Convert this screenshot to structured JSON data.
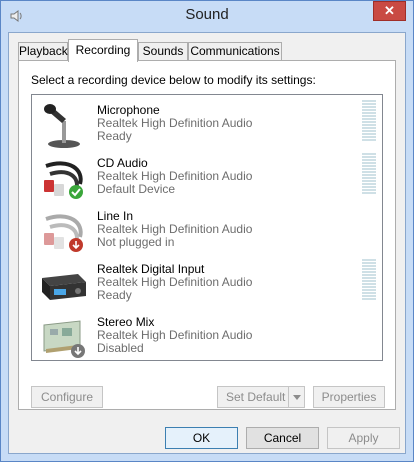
{
  "window": {
    "title": "Sound",
    "close_glyph": "✕"
  },
  "tabs": [
    {
      "label": "Playback",
      "active": false
    },
    {
      "label": "Recording",
      "active": true
    },
    {
      "label": "Sounds",
      "active": false
    },
    {
      "label": "Communications",
      "active": false
    }
  ],
  "instruction": "Select a recording device below to modify its settings:",
  "devices": [
    {
      "name": "Microphone",
      "description": "Realtek High Definition Audio",
      "status": "Ready",
      "icon": "microphone-icon",
      "has_meter": true,
      "badge": ""
    },
    {
      "name": "CD Audio",
      "description": "Realtek High Definition Audio",
      "status": "Default Device",
      "icon": "cd-audio-cable-icon",
      "has_meter": true,
      "badge": "check"
    },
    {
      "name": "Line In",
      "description": "Realtek High Definition Audio",
      "status": "Not plugged in",
      "icon": "line-in-cable-icon",
      "has_meter": false,
      "badge": "unplugged"
    },
    {
      "name": "Realtek Digital Input",
      "description": "Realtek High Definition Audio",
      "status": "Ready",
      "icon": "digital-input-icon",
      "has_meter": true,
      "badge": ""
    },
    {
      "name": "Stereo Mix",
      "description": "Realtek High Definition Audio",
      "status": "Disabled",
      "icon": "stereo-mix-card-icon",
      "has_meter": false,
      "badge": "disabled"
    }
  ],
  "buttons": {
    "configure": "Configure",
    "set_default": "Set Default",
    "properties": "Properties",
    "ok": "OK",
    "cancel": "Cancel",
    "apply": "Apply"
  },
  "colors": {
    "title_bar": "#c7dcf6",
    "close_button": "#c94a43",
    "default_check": "#3aa63a",
    "unplugged_badge": "#c0392b"
  }
}
